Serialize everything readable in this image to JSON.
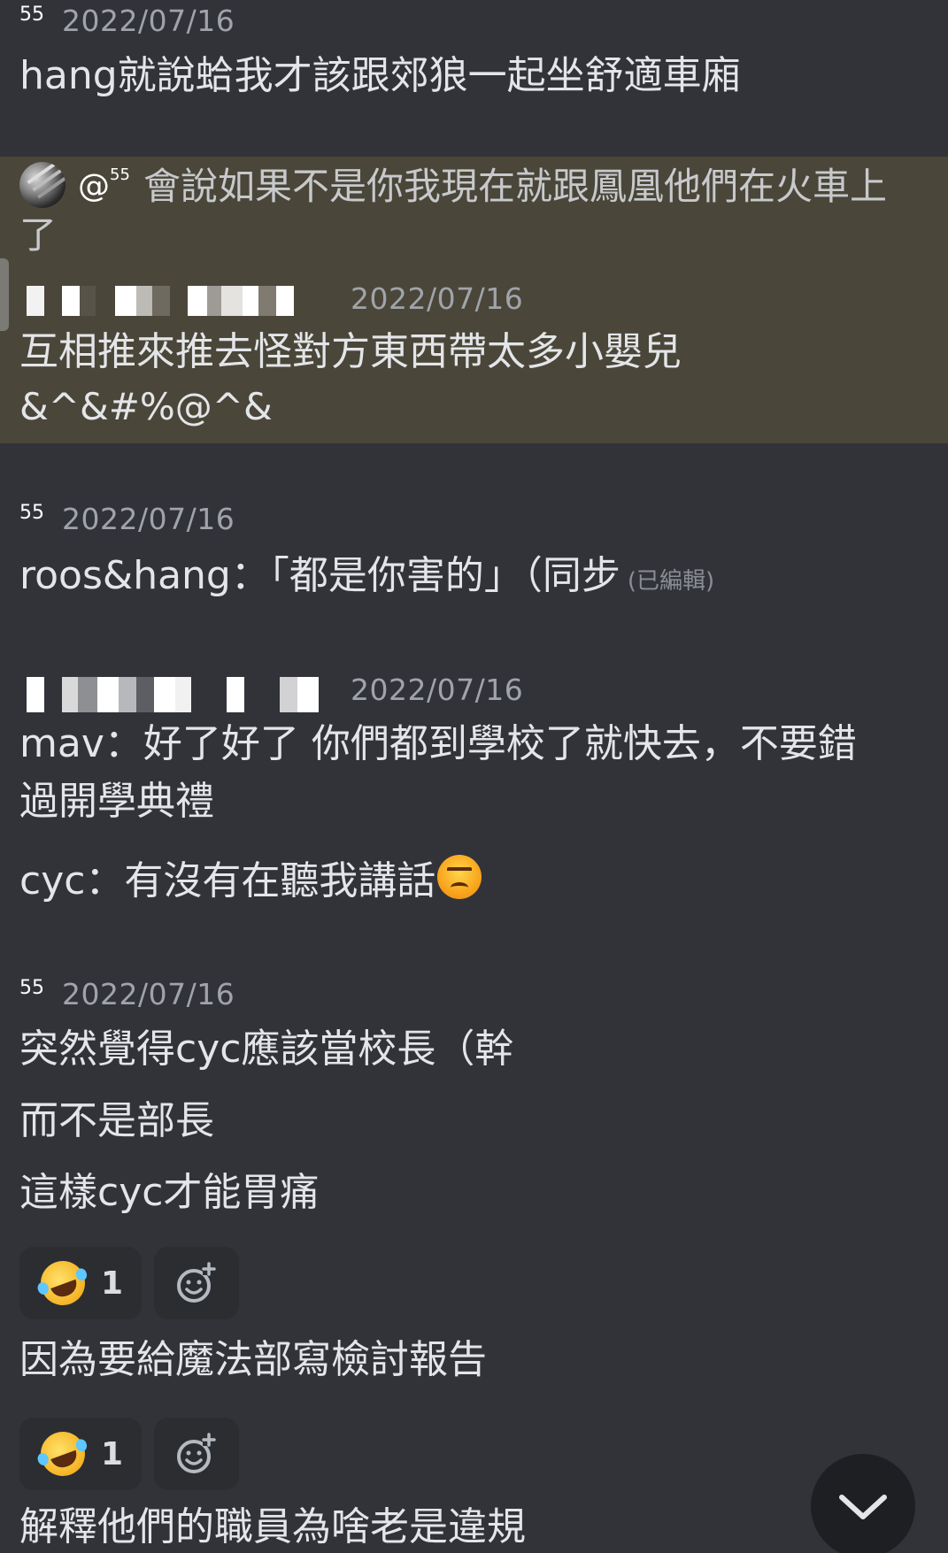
{
  "messages": [
    {
      "username": "55",
      "timestamp": "2022/07/16",
      "lines": [
        "hang就說蛤我才該跟郊狼一起坐舒適車廂"
      ]
    },
    {
      "reply": {
        "mention": "@",
        "mention_sup": "55",
        "text_line1": "會說如果不是你我現在就跟鳳凰他們在火車上",
        "text_line2": "了"
      },
      "username_pixelated": true,
      "timestamp": "2022/07/16",
      "lines": [
        "互相推來推去怪對方東西帶太多小嬰兒",
        "&^&#%@^&"
      ]
    },
    {
      "username": "55",
      "timestamp": "2022/07/16",
      "line_main": "roos&hang：「都是你害的」（同步",
      "edited_label": "(已編輯)"
    },
    {
      "username_pixelated": true,
      "timestamp": "2022/07/16",
      "lines": [
        "mav：好了好了 你們都到學校了就快去，不要錯",
        "過開學典禮",
        "cyc：有沒有在聽我講話"
      ],
      "emoji": "angry-face"
    },
    {
      "username": "55",
      "timestamp": "2022/07/16",
      "lines": [
        "突然覺得cyc應該當校長（幹",
        "而不是部長",
        "這樣cyc才能胃痛",
        "因為要給魔法部寫檢討報告",
        "解釋他們的職員為啥老是違規"
      ],
      "reactions": [
        {
          "emoji": "rolling-on-floor-laughing",
          "count": "1"
        },
        {
          "emoji": "rolling-on-floor-laughing",
          "count": "1"
        }
      ]
    }
  ],
  "icons": {
    "add_reaction": "add-reaction-icon",
    "scroll_down": "chevron-down-icon"
  },
  "colors": {
    "background": "#313338",
    "highlight": "#4a4639",
    "chip": "#2b2d31"
  }
}
